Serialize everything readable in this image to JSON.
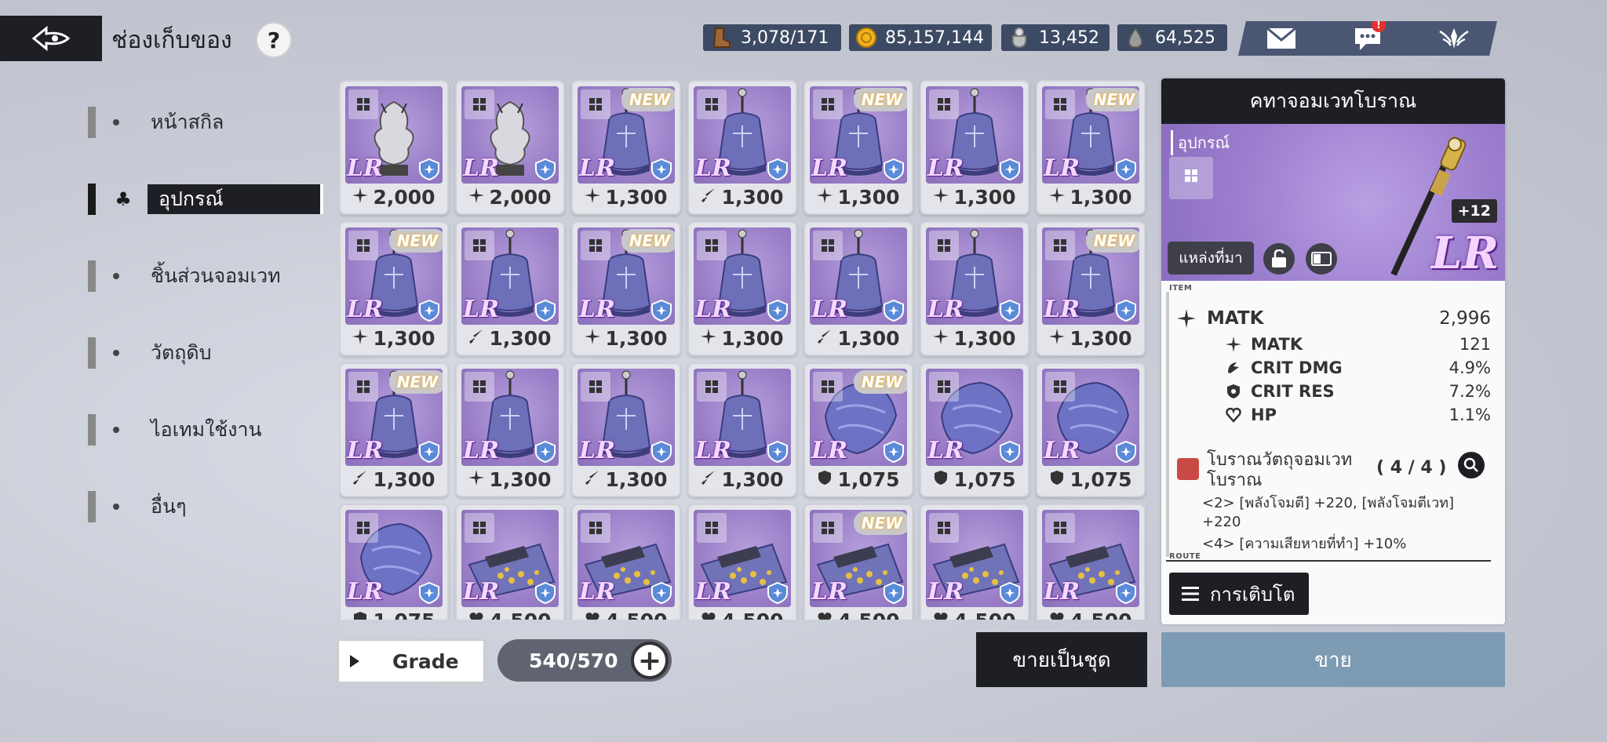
{
  "header": {
    "title": "ช่องเก็บของ",
    "help_label": "?"
  },
  "resources": [
    {
      "icon": "boot-icon",
      "value": "3,078/171"
    },
    {
      "icon": "gold-coin-icon",
      "value": "85,157,144"
    },
    {
      "icon": "stone-bag-icon",
      "value": "13,452"
    },
    {
      "icon": "crystal-icon",
      "value": "64,525"
    }
  ],
  "top_buttons": {
    "notification_badge": "!"
  },
  "sidebar": {
    "items": [
      {
        "label": "หน้าสกิล"
      },
      {
        "label": "อุปกรณ์"
      },
      {
        "label": "ชิ้นส่วนจอมเวท"
      },
      {
        "label": "วัตถุดิบ"
      },
      {
        "label": "ไอเทมใช้งาน"
      },
      {
        "label": "อื่นๆ"
      }
    ]
  },
  "inventory": {
    "rarity_label": "LR",
    "new_label": "NEW",
    "items": [
      {
        "art": "dragon",
        "stat_icon": "sparkle",
        "value": "2,000",
        "is_new": false
      },
      {
        "art": "dragon",
        "stat_icon": "sparkle",
        "value": "2,000",
        "is_new": false
      },
      {
        "art": "bell",
        "stat_icon": "sparkle",
        "value": "1,300",
        "is_new": true
      },
      {
        "art": "bell",
        "stat_icon": "sword",
        "value": "1,300",
        "is_new": false
      },
      {
        "art": "bell",
        "stat_icon": "sparkle",
        "value": "1,300",
        "is_new": true
      },
      {
        "art": "bell",
        "stat_icon": "sparkle",
        "value": "1,300",
        "is_new": false
      },
      {
        "art": "bell",
        "stat_icon": "sparkle",
        "value": "1,300",
        "is_new": true
      },
      {
        "art": "bell",
        "stat_icon": "sparkle",
        "value": "1,300",
        "is_new": true
      },
      {
        "art": "bell",
        "stat_icon": "sword",
        "value": "1,300",
        "is_new": false
      },
      {
        "art": "bell",
        "stat_icon": "sparkle",
        "value": "1,300",
        "is_new": true
      },
      {
        "art": "bell",
        "stat_icon": "sparkle",
        "value": "1,300",
        "is_new": false
      },
      {
        "art": "bell",
        "stat_icon": "sword",
        "value": "1,300",
        "is_new": false
      },
      {
        "art": "bell",
        "stat_icon": "sparkle",
        "value": "1,300",
        "is_new": false
      },
      {
        "art": "bell",
        "stat_icon": "sparkle",
        "value": "1,300",
        "is_new": true
      },
      {
        "art": "bell",
        "stat_icon": "sword",
        "value": "1,300",
        "is_new": true
      },
      {
        "art": "bell",
        "stat_icon": "sparkle",
        "value": "1,300",
        "is_new": false
      },
      {
        "art": "bell",
        "stat_icon": "sword",
        "value": "1,300",
        "is_new": false
      },
      {
        "art": "bell",
        "stat_icon": "sword",
        "value": "1,300",
        "is_new": false
      },
      {
        "art": "cloak",
        "stat_icon": "shield",
        "value": "1,075",
        "is_new": true
      },
      {
        "art": "cloak",
        "stat_icon": "shield",
        "value": "1,075",
        "is_new": false
      },
      {
        "art": "cloak",
        "stat_icon": "shield",
        "value": "1,075",
        "is_new": false
      },
      {
        "art": "cloak",
        "stat_icon": "shield",
        "value": "1,075",
        "is_new": false
      },
      {
        "art": "gems",
        "stat_icon": "heart",
        "value": "4,500",
        "is_new": false
      },
      {
        "art": "gems",
        "stat_icon": "heart",
        "value": "4,500",
        "is_new": false
      },
      {
        "art": "gems",
        "stat_icon": "heart",
        "value": "4,500",
        "is_new": false
      },
      {
        "art": "gems",
        "stat_icon": "heart",
        "value": "4,500",
        "is_new": true
      },
      {
        "art": "gems",
        "stat_icon": "heart",
        "value": "4,500",
        "is_new": false
      },
      {
        "art": "gems",
        "stat_icon": "heart",
        "value": "4,500",
        "is_new": false
      }
    ]
  },
  "bottom": {
    "grade_label": "Grade",
    "capacity": "540/570",
    "plus_label": "+",
    "bulk_sell_label": "ขายเป็นชุด",
    "sell_label": "ขาย"
  },
  "detail": {
    "name": "คทาจอมเวทโบราณ",
    "category": "อุปกรณ์",
    "source_label": "แหล่งที่มา",
    "enhance_level": "+12",
    "rarity": "LR",
    "item_tag": "ITEM",
    "main_stat": {
      "name": "MATK",
      "value": "2,996"
    },
    "sub_stats": [
      {
        "icon": "sparkle-icon",
        "name": "MATK",
        "value": "121"
      },
      {
        "icon": "crit-dmg-icon",
        "name": "CRIT DMG",
        "value": "4.9%"
      },
      {
        "icon": "crit-res-icon",
        "name": "CRIT RES",
        "value": "7.2%"
      },
      {
        "icon": "heart-icon",
        "name": "HP",
        "value": "1.1%"
      }
    ],
    "set": {
      "name": "โบราณวัตถุจอมเวทโบราณ",
      "count": "( 4 / 4 )",
      "bonuses": [
        "<2> [พลังโจมตี] +220, [พลังโจมตีเวท] +220",
        "<4> [ความเสียหายที่ทำ] +10%"
      ]
    },
    "route_tag": "ROUTE",
    "growth_label": "การเติบโต"
  }
}
